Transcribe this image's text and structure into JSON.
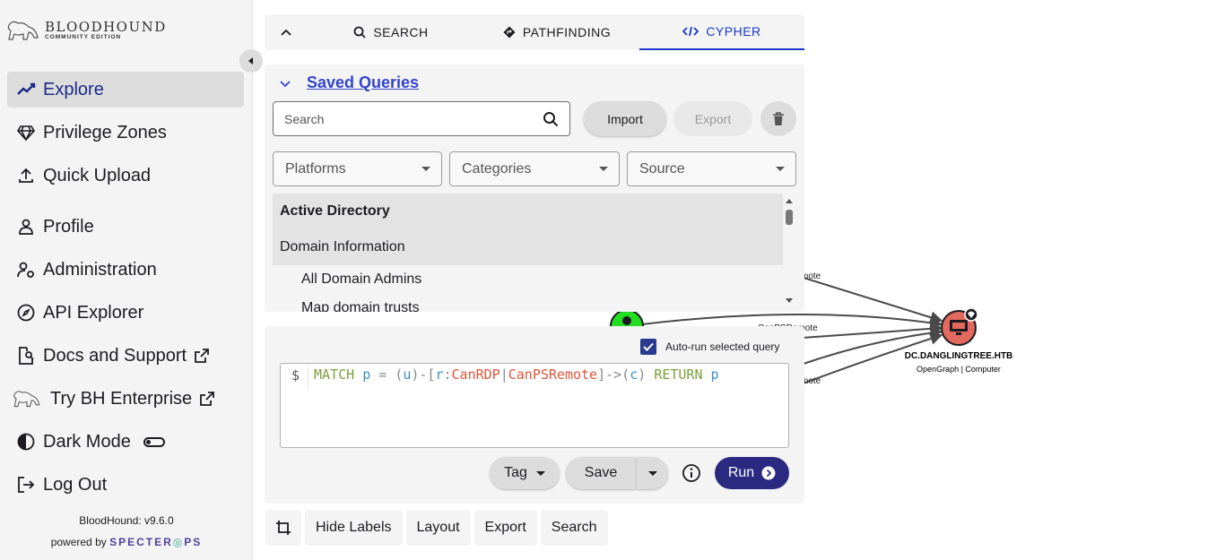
{
  "brand": {
    "line1": "BLOODHOUND",
    "line2": "COMMUNITY EDITION"
  },
  "nav": {
    "explore": "Explore",
    "privilege_zones": "Privilege Zones",
    "quick_upload": "Quick Upload",
    "profile": "Profile",
    "administration": "Administration",
    "api_explorer": "API Explorer",
    "docs": "Docs and Support",
    "try_enterprise": "Try BH Enterprise",
    "dark_mode": "Dark Mode",
    "log_out": "Log Out"
  },
  "footer": {
    "version": "BloodHound: v9.6.0",
    "powered_by": "powered by",
    "company": "SPECTER",
    "company_end": "PS"
  },
  "tabs": {
    "search": "SEARCH",
    "pathfinding": "PATHFINDING",
    "cypher": "CYPHER"
  },
  "saved_queries": {
    "title": "Saved Queries",
    "search_placeholder": "Search",
    "import": "Import",
    "export": "Export",
    "platforms": "Platforms",
    "categories": "Categories",
    "source": "Source",
    "group": "Active Directory",
    "subgroup": "Domain Information",
    "items": [
      "All Domain Admins",
      "Map domain trusts"
    ]
  },
  "editor": {
    "autorun_label": "Auto-run selected query",
    "autorun_checked": true,
    "prompt": "$",
    "code": {
      "kw1": "MATCH",
      "p": "p",
      "eq": "=",
      "lp": "(",
      "u": "u",
      "rp": ")-[",
      "r": "r",
      "colon": ":",
      "rel1": "CanRDP",
      "pipe": "|",
      "rel2": "CanPSRemote",
      "arrow": "]->(",
      "c": "c",
      "rc": ")",
      "kw2": "RETURN",
      "p2": "p"
    },
    "tag": "Tag",
    "save": "Save",
    "run": "Run"
  },
  "toolbar": {
    "hide_labels": "Hide Labels",
    "layout": "Layout",
    "export": "Export",
    "search": "Search"
  },
  "graph": {
    "node_name": "DC.DANGLINGTREE.HTB",
    "node_type": "OpenGraph | Computer",
    "edge_1": "mote",
    "edge_2": "CanPSRemote",
    "edge_3": "mote",
    "colors": {
      "target_node": "#e2695f",
      "source_node": "#22dd22",
      "edge": "#4a4a4a"
    }
  }
}
